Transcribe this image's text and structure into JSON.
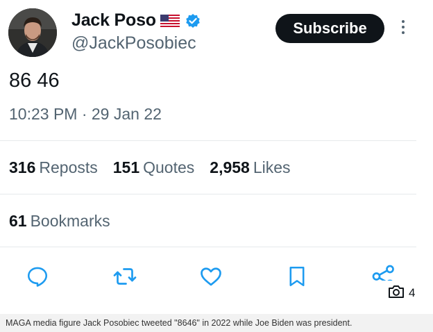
{
  "author": {
    "display_name": "Jack Poso",
    "handle": "@JackPosobiec",
    "verified_color": "#1d9bf0"
  },
  "subscribe_label": "Subscribe",
  "tweet": {
    "text": "86 46",
    "timestamp": "10:23 PM · 29 Jan 22"
  },
  "stats": {
    "reposts_count": "316",
    "reposts_label": "Reposts",
    "quotes_count": "151",
    "quotes_label": "Quotes",
    "likes_count": "2,958",
    "likes_label": "Likes",
    "bookmarks_count": "61",
    "bookmarks_label": "Bookmarks"
  },
  "actions": [
    "reply-icon",
    "repost-icon",
    "like-icon",
    "bookmark-icon",
    "share-icon"
  ],
  "photo_badge": {
    "icon": "camera-icon",
    "count": "4"
  },
  "caption": "MAGA media figure Jack Posobiec tweeted \"8646\" in 2022 while Joe Biden was president."
}
